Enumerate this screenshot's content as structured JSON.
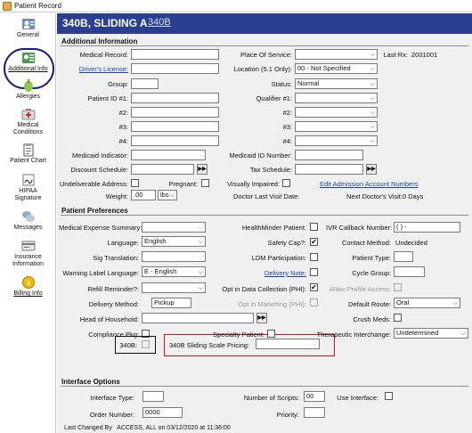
{
  "window": {
    "title": "Patient Record"
  },
  "sidebar": {
    "items": [
      {
        "label": "General"
      },
      {
        "label": "Additional Info"
      },
      {
        "label": "Allergies"
      },
      {
        "label": "Medical",
        "label2": "Conditions"
      },
      {
        "label": "Patient Chart"
      },
      {
        "label": "HIPAA",
        "label2": "Signature"
      },
      {
        "label": "Messages"
      },
      {
        "label": "Insurance",
        "label2": "Information"
      },
      {
        "label": "Billing Info"
      }
    ]
  },
  "header": {
    "title": "340B, SLIDING A",
    "link": "340B"
  },
  "additional": {
    "title": "Additional Information",
    "medical_record": {
      "label": "Medical Record:",
      "value": ""
    },
    "drivers_license": {
      "label": "Driver's License:",
      "value": ""
    },
    "group": {
      "label": "Group:",
      "value": ""
    },
    "patient_id1": {
      "label": "Patient ID #1:",
      "value": ""
    },
    "id2": {
      "label": "#2:",
      "value": ""
    },
    "id3": {
      "label": "#3:",
      "value": ""
    },
    "id4": {
      "label": "#4:",
      "value": ""
    },
    "medicaid_indicator": {
      "label": "Medicaid Indicator:",
      "value": ""
    },
    "discount_schedule": {
      "label": "Discount Schedule:",
      "value": "",
      "btn": "▶▶"
    },
    "undeliverable": {
      "label": "Undeliverable Address:"
    },
    "pregnant": {
      "label": "Pregnant:"
    },
    "weight": {
      "label": "Weight:",
      "value": ".00",
      "unit": "lbs"
    },
    "place_of_service": {
      "label": "Place Of Service:",
      "value": ""
    },
    "last_rx": {
      "label": "Last Rx:",
      "value": "2001001"
    },
    "location": {
      "label": "Location (5.1 Only):",
      "value": "00 - Not Specified"
    },
    "status": {
      "label": "Status:",
      "value": "Normal"
    },
    "qualifier1": {
      "label": "Qualifier #1:",
      "value": ""
    },
    "q2": {
      "label": "#2:",
      "value": ""
    },
    "q3": {
      "label": "#3:",
      "value": ""
    },
    "q4": {
      "label": "#4:",
      "value": ""
    },
    "medicaid_id": {
      "label": "Medicaid ID Number:",
      "value": ""
    },
    "tax_schedule": {
      "label": "Tax Schedule:",
      "value": "",
      "btn": "▶▶"
    },
    "visually_impaired": {
      "label": "Visually Impaired:"
    },
    "edit_admission": "Edit Admission Account Numbers",
    "doctor_last_visit": {
      "label": "Doctor Last Visit Date:",
      "value": ""
    },
    "next_doctor_visit": {
      "label": "Next Doctor's Visit:",
      "value": "0 Days"
    }
  },
  "preferences": {
    "title": "Patient Preferences",
    "medical_expense": {
      "label": "Medical Expense Summary:",
      "value": ""
    },
    "language": {
      "label": "Language:",
      "value": "English"
    },
    "sig_translation": {
      "label": "Sig Translation:",
      "value": ""
    },
    "warning_label": {
      "label": "Warning Label Language:",
      "value": "E - English"
    },
    "refill_reminder": {
      "label": "Refill Reminder?:",
      "value": ""
    },
    "delivery_method": {
      "label": "Delivery Method:",
      "value": "Pickup"
    },
    "head_of_household": {
      "label": "Head of Household:",
      "value": "",
      "btn": "▶▶"
    },
    "compliance_pkg": {
      "label": "Compliance Pkg:"
    },
    "b340": {
      "label": "340B:"
    },
    "healthminder": {
      "label": "HealthMinder Patient:"
    },
    "safety_cap": {
      "label": "Safety Cap?:",
      "checked": "✔"
    },
    "ldm": {
      "label": "LDM Participation:"
    },
    "delivery_note": {
      "label": "Delivery Note:"
    },
    "opt_data": {
      "label": "Opt in Data Collection (PHI):",
      "checked": "✔"
    },
    "opt_marketing": {
      "label": "Opt in Marketing (PHI):"
    },
    "specialty": {
      "label": "Specialty Patient:"
    },
    "ivr": {
      "label": "IVR Callback Number:",
      "value": "(  )   -"
    },
    "contact_method": {
      "label": "Contact Method:",
      "value": "Undecided"
    },
    "patient_type": {
      "label": "Patient Type:",
      "value": ""
    },
    "cycle_group": {
      "label": "Cycle Group:",
      "value": ""
    },
    "allow_profile": {
      "label": "Allow Profile Access:"
    },
    "default_route": {
      "label": "Default Route:",
      "value": "Oral"
    },
    "crush_meds": {
      "label": "Crush Meds:"
    },
    "therapeutic": {
      "label": "Therapeutic Interchange:",
      "value": "Undetermined"
    },
    "sliding_scale": {
      "label": "340B Sliding Scale Pricing:",
      "value": ""
    }
  },
  "interface": {
    "title": "Interface Options",
    "interface_type": {
      "label": "Interface Type:",
      "value": ""
    },
    "order_number": {
      "label": "Order Number:",
      "value": "0000"
    },
    "number_scripts": {
      "label": "Number of Scripts:",
      "value": "00"
    },
    "use_interface": {
      "label": "Use Interface:"
    },
    "priority": {
      "label": "Priority:",
      "value": ""
    }
  },
  "footer": {
    "last_changed": "Last Changed By   ACCESS, ALL on 03/12/2020 at 11:36:00"
  },
  "colors": {
    "header_bg": "#2a3f8f",
    "link": "#1a3fc0",
    "highlight_red": "#b81c1c",
    "highlight_navy": "#1a1a8c"
  }
}
